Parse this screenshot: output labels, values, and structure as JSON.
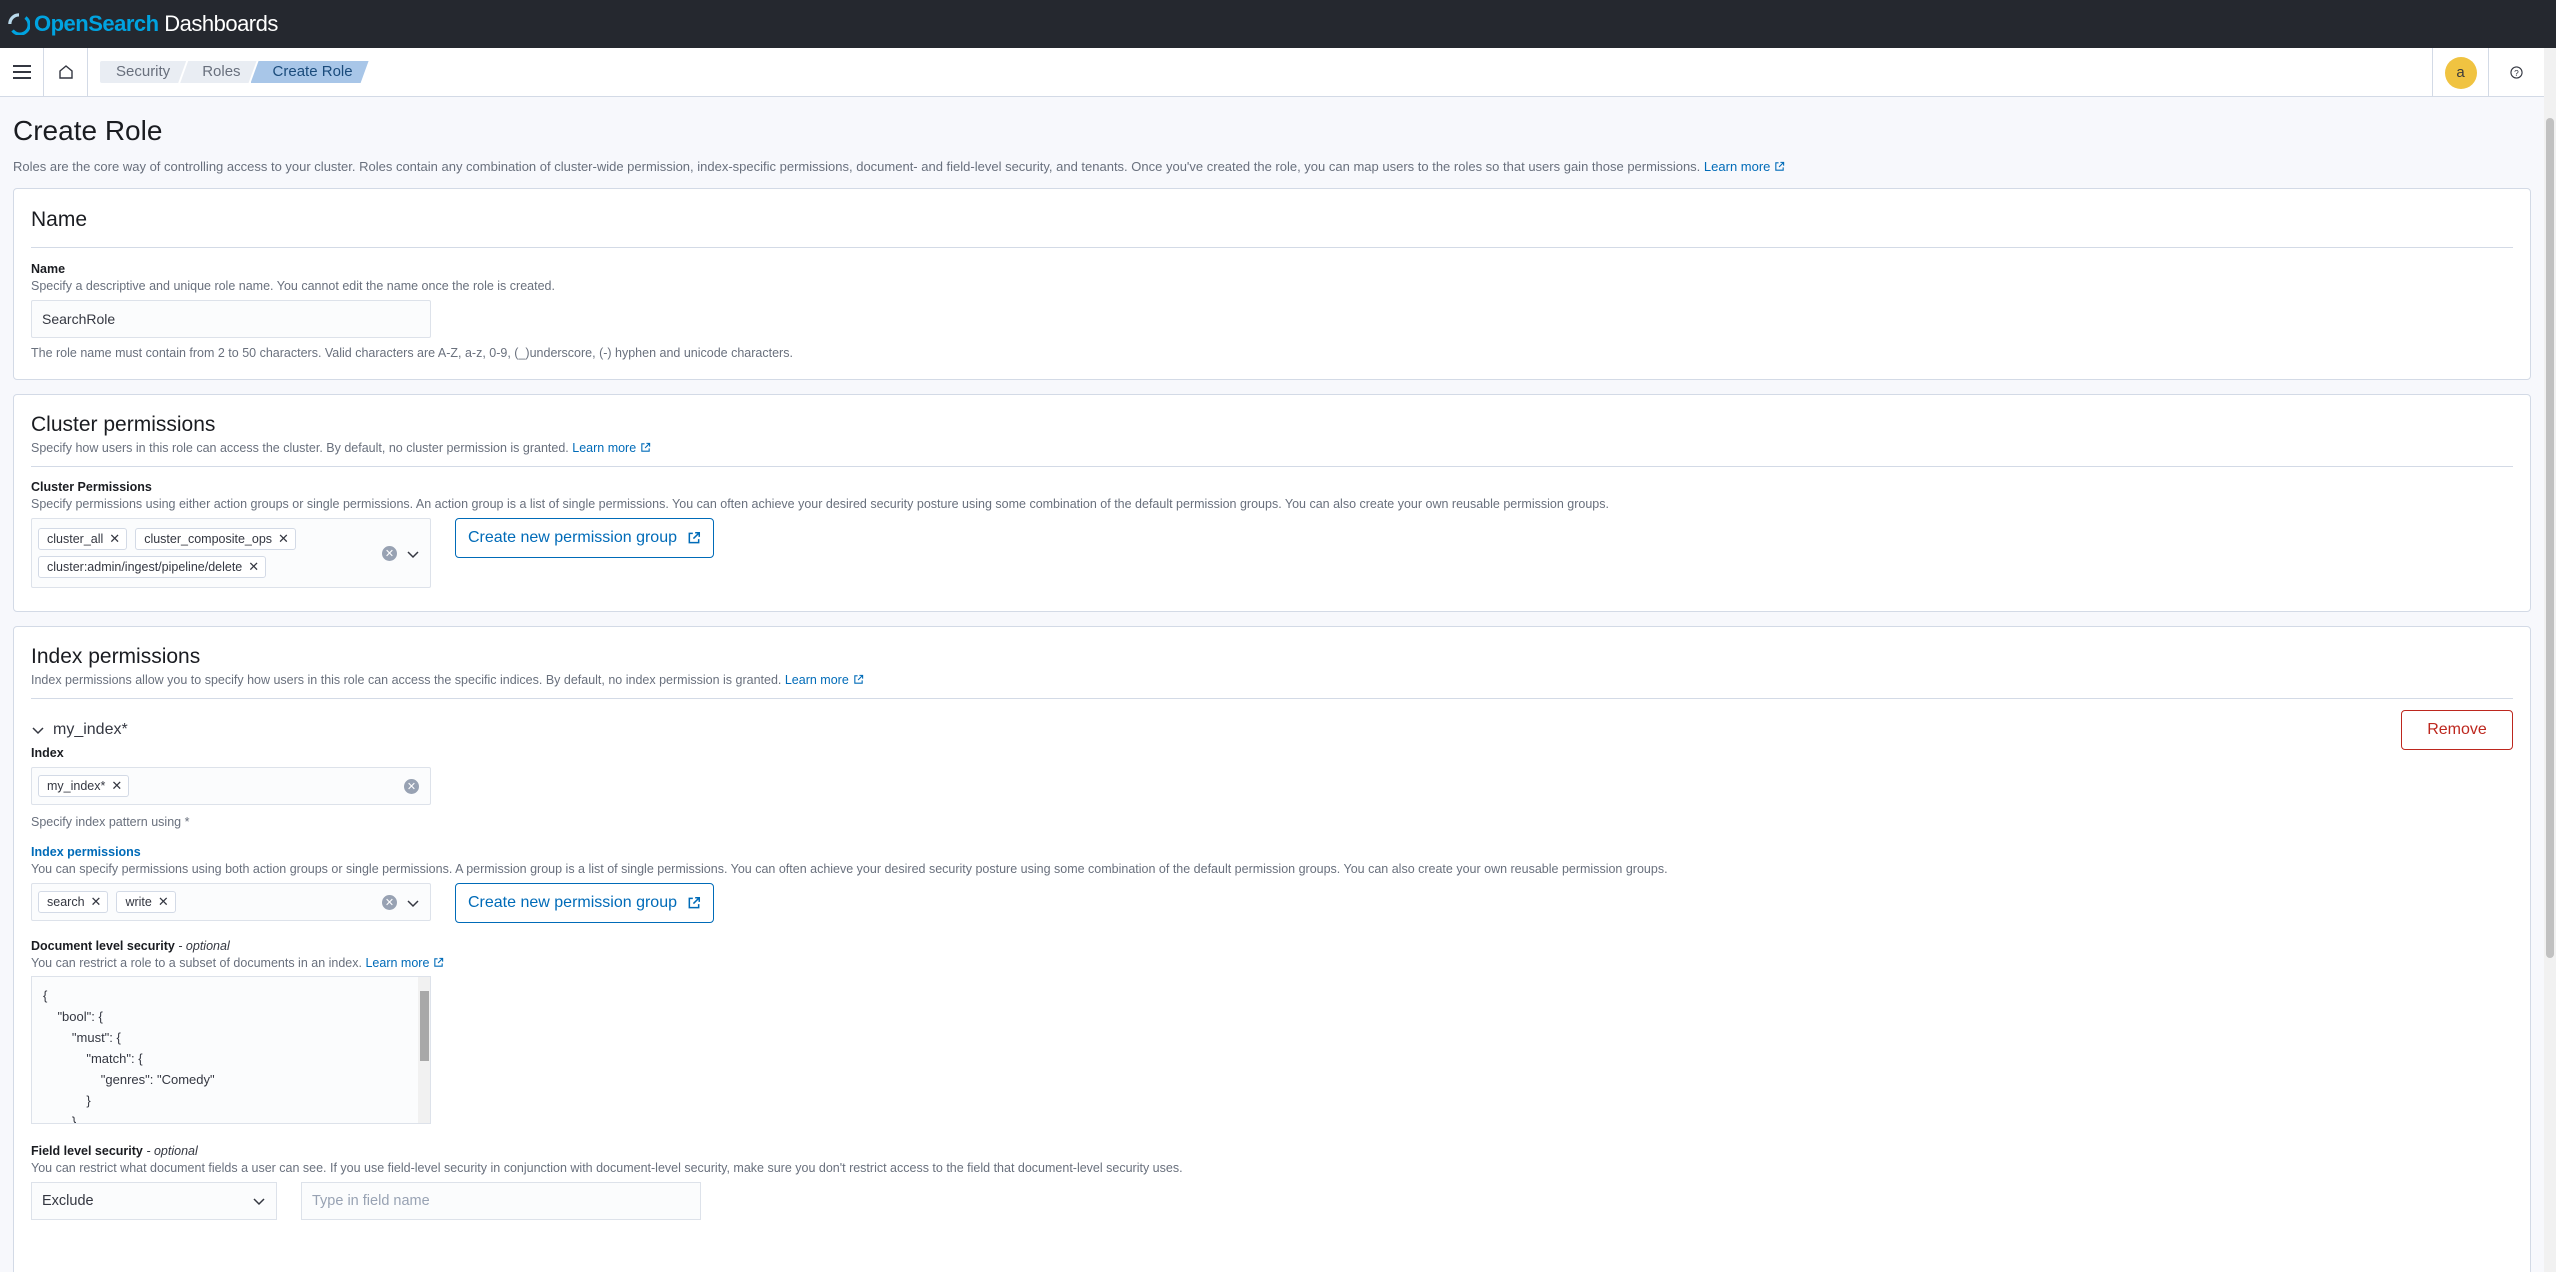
{
  "header": {
    "logo_brand": "OpenSearch",
    "logo_product": "Dashboards"
  },
  "navbar": {
    "breadcrumbs": [
      "Security",
      "Roles",
      "Create Role"
    ],
    "avatar_initial": "a"
  },
  "page": {
    "title": "Create Role",
    "description": "Roles are the core way of controlling access to your cluster. Roles contain any combination of cluster-wide permission, index-specific permissions, document- and field-level security, and tenants. Once you've created the role, you can map users to the roles so that users gain those permissions.",
    "learn_more": "Learn more"
  },
  "name_panel": {
    "heading": "Name",
    "label": "Name",
    "help": "Specify a descriptive and unique role name. You cannot edit the name once the role is created.",
    "value": "SearchRole",
    "hint": "The role name must contain from 2 to 50 characters. Valid characters are A-Z, a-z, 0-9, (_)underscore, (-) hyphen and unicode characters."
  },
  "cluster_panel": {
    "heading": "Cluster permissions",
    "description": "Specify how users in this role can access the cluster. By default, no cluster permission is granted.",
    "learn_more": "Learn more",
    "label": "Cluster Permissions",
    "help": "Specify permissions using either action groups or single permissions. An action group is a list of single permissions. You can often achieve your desired security posture using some combination of the default permission groups. You can also create your own reusable permission groups.",
    "selected": [
      "cluster_all",
      "cluster_composite_ops",
      "cluster:admin/ingest/pipeline/delete"
    ],
    "create_button": "Create new permission group"
  },
  "index_panel": {
    "heading": "Index permissions",
    "description": "Index permissions allow you to specify how users in this role can access the specific indices. By default, no index permission is granted.",
    "learn_more": "Learn more",
    "entry_title": "my_index*",
    "remove_button": "Remove",
    "index_label": "Index",
    "index_selected": [
      "my_index*"
    ],
    "index_hint": "Specify index pattern using *",
    "perm_label": "Index permissions",
    "perm_help": "You can specify permissions using both action groups or single permissions. A permission group is a list of single permissions. You can often achieve your desired security posture using some combination of the default permission groups. You can also create your own reusable permission groups.",
    "perm_selected": [
      "search",
      "write"
    ],
    "create_button": "Create new permission group",
    "dls_label": "Document level security",
    "optional": "- optional",
    "dls_help": "You can restrict a role to a subset of documents in an index.",
    "dls_learn_more": "Learn more",
    "dls_code": "{\n    \"bool\": {\n        \"must\": {\n            \"match\": {\n                \"genres\": \"Comedy\"\n            }\n        }",
    "fls_label": "Field level security",
    "fls_help": "You can restrict what document fields a user can see. If you use field-level security in conjunction with document-level security, make sure you don't restrict access to the field that document-level security uses.",
    "fls_mode": "Exclude",
    "fls_placeholder": "Type in field name"
  },
  "colors": {
    "accent": "#006bb8",
    "danger": "#bd271e",
    "topbar": "#25282f",
    "avatar": "#f0c341"
  }
}
